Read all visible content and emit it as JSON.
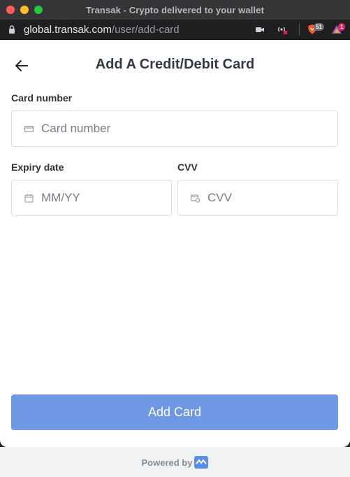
{
  "window": {
    "title": "Transak - Crypto delivered to your wallet"
  },
  "browser": {
    "url_domain": "global.transak.com",
    "url_path": "/user/add-card",
    "brave_badge_count": "51",
    "extension_badge_count": "1"
  },
  "header": {
    "title": "Add A Credit/Debit Card"
  },
  "form": {
    "card_number_label": "Card number",
    "card_number_placeholder": "Card number",
    "expiry_label": "Expiry date",
    "expiry_placeholder": "MM/YY",
    "cvv_label": "CVV",
    "cvv_placeholder": "CVV"
  },
  "actions": {
    "add_card_label": "Add Card"
  },
  "footer": {
    "powered_by": "Powered by"
  },
  "colors": {
    "primary": "#6f97e4",
    "brand": "#5b8fe6"
  },
  "icons": [
    "lock-icon",
    "camera-icon",
    "broadcast-off-icon",
    "brave-shield-icon",
    "extension-icon",
    "back-arrow-icon",
    "credit-card-icon",
    "calendar-icon",
    "cvv-card-icon",
    "transak-logo-icon"
  ]
}
